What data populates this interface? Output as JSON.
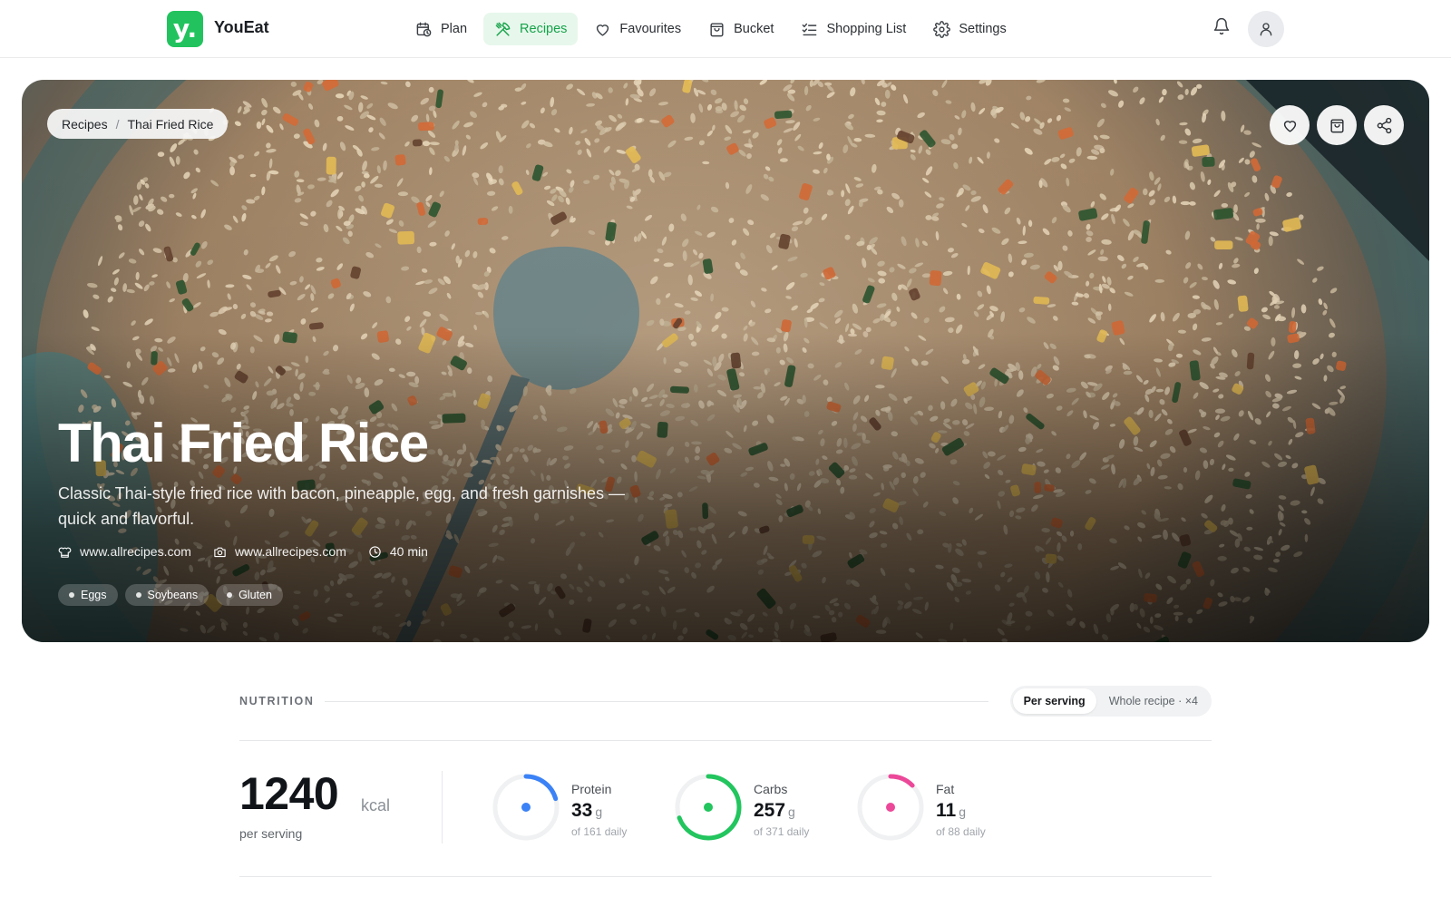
{
  "app": {
    "brand": "YouEat",
    "logo_glyph": "y."
  },
  "nav": {
    "items": [
      {
        "label": "Plan",
        "icon": "calendar-clock-icon",
        "active": false
      },
      {
        "label": "Recipes",
        "icon": "utensils-icon",
        "active": true
      },
      {
        "label": "Favourites",
        "icon": "heart-icon",
        "active": false
      },
      {
        "label": "Bucket",
        "icon": "shopping-bag-icon",
        "active": false
      },
      {
        "label": "Shopping List",
        "icon": "list-checks-icon",
        "active": false
      },
      {
        "label": "Settings",
        "icon": "gear-icon",
        "active": false
      }
    ]
  },
  "breadcrumb": {
    "parent": "Recipes",
    "separator": "/",
    "current": "Thai Fried Rice"
  },
  "hero": {
    "title": "Thai Fried Rice",
    "description": "Classic Thai-style fried rice with bacon, pineapple, egg, and fresh garnishes — quick and flavorful.",
    "meta": {
      "source": "www.allrecipes.com",
      "photo_credit": "www.allrecipes.com",
      "time": "40 min"
    },
    "allergens": [
      "Eggs",
      "Soybeans",
      "Gluten"
    ],
    "actions": [
      "favourite-icon",
      "add-to-bucket-icon",
      "share-icon"
    ]
  },
  "nutrition": {
    "label": "NUTRITION",
    "toggle": {
      "per_serving": "Per serving",
      "whole_recipe": "Whole recipe · ×4",
      "selected": "per_serving"
    },
    "calories": {
      "value": "1240",
      "unit": "kcal",
      "sub": "per serving"
    },
    "macros": [
      {
        "name": "Protein",
        "value": "33",
        "unit": "g",
        "daily": "of 161 daily",
        "fraction": 0.205,
        "color": "#3b82f6"
      },
      {
        "name": "Carbs",
        "value": "257",
        "unit": "g",
        "daily": "of 371 daily",
        "fraction": 0.693,
        "color": "#22c55e"
      },
      {
        "name": "Fat",
        "value": "11",
        "unit": "g",
        "daily": "of 88 daily",
        "fraction": 0.125,
        "color": "#ec4899"
      }
    ]
  },
  "colors": {
    "accent": "#16a34a",
    "accent_bg": "#e7f7ec",
    "logo": "#22c35e"
  }
}
